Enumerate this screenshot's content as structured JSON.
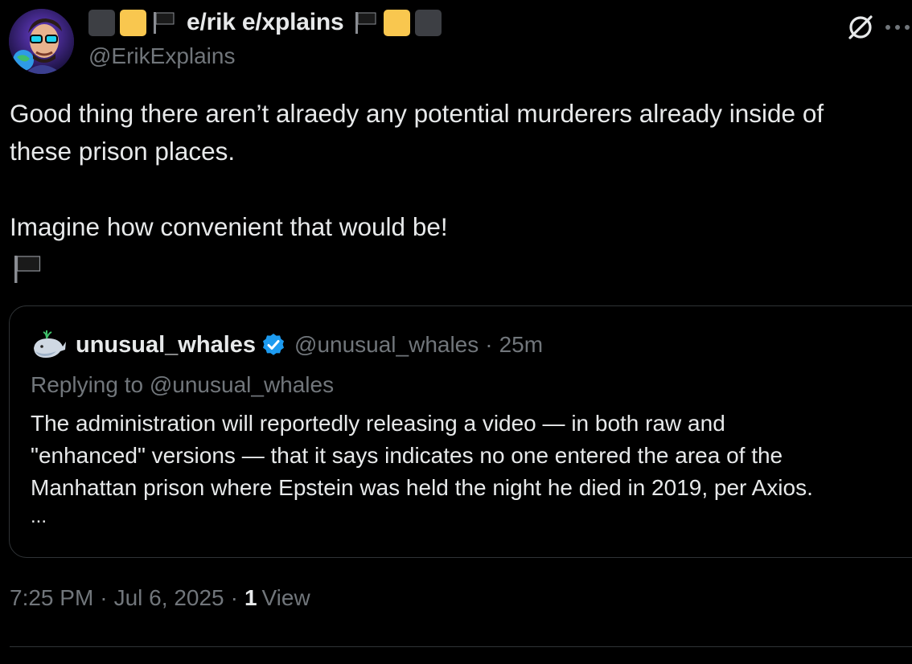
{
  "author": {
    "display_name": "e/rik e/xplains",
    "handle": "@ErikExplains",
    "avatar_icon": "avatar-image",
    "name_decorations_left": [
      "dark-square",
      "yellow-square",
      "black-flag"
    ],
    "name_decorations_right": [
      "black-flag",
      "yellow-square",
      "dark-square"
    ]
  },
  "tweet": {
    "lines": [
      "Good thing there aren’t alraedy any potential murderers already inside of",
      "these prison places.",
      "",
      "Imagine how convenient that would be!"
    ],
    "trailing_emoji": "black-flag"
  },
  "quote": {
    "author_name": "unusual_whales",
    "handle": "@unusual_whales",
    "separator": "·",
    "time": "25m",
    "replying_to": "Replying to @unusual_whales",
    "body_lines": [
      "The administration will reportedly releasing a video — in both raw and",
      "\"enhanced\" versions — that it says indicates no one entered the area of the",
      "Manhattan prison where Epstein was held the night he died in 2019, per Axios."
    ],
    "ellipsis": "..."
  },
  "meta": {
    "time": "7:25 PM",
    "separator1": "·",
    "date": "Jul 6, 2025",
    "separator2": "·",
    "views_count": "1",
    "views_label": "View"
  },
  "icons": {
    "grok": "grok-icon",
    "more": "more-icon",
    "verified": "verified-badge-icon",
    "whale": "whale-avatar-icon"
  },
  "colors": {
    "background": "#000000",
    "text_primary": "#e7e9ea",
    "text_secondary": "#71767b",
    "border": "#2f3336",
    "verified_blue": "#1d9bf0",
    "accent_yellow": "#f9c74f"
  }
}
